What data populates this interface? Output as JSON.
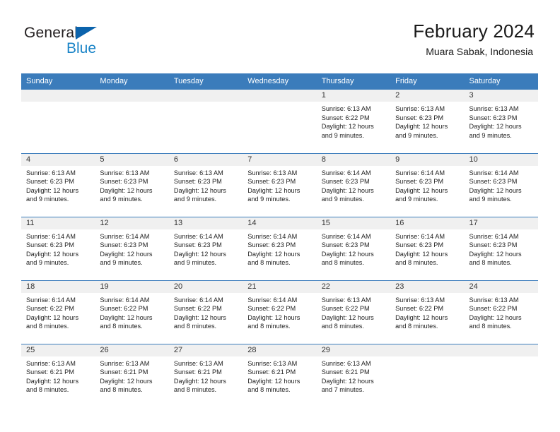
{
  "brand": {
    "name_top": "General",
    "name_bottom": "Blue",
    "triangle_color": "#0b63ac",
    "blue_text_color": "#1a84c7"
  },
  "header": {
    "title": "February 2024",
    "subtitle": "Muara Sabak, Indonesia"
  },
  "theme": {
    "header_blue": "#3b7cbb",
    "daynum_band": "#f0f0f0",
    "text": "#222222"
  },
  "weekday_headers": [
    "Sunday",
    "Monday",
    "Tuesday",
    "Wednesday",
    "Thursday",
    "Friday",
    "Saturday"
  ],
  "labels": {
    "sunrise_prefix": "Sunrise:",
    "sunset_prefix": "Sunset:",
    "daylight_prefix": "Daylight:"
  },
  "weeks": [
    [
      {
        "day": "",
        "sunrise": "",
        "sunset": "",
        "daylight_line1": "",
        "daylight_line2": "",
        "empty": true
      },
      {
        "day": "",
        "sunrise": "",
        "sunset": "",
        "daylight_line1": "",
        "daylight_line2": "",
        "empty": true
      },
      {
        "day": "",
        "sunrise": "",
        "sunset": "",
        "daylight_line1": "",
        "daylight_line2": "",
        "empty": true
      },
      {
        "day": "",
        "sunrise": "",
        "sunset": "",
        "daylight_line1": "",
        "daylight_line2": "",
        "empty": true
      },
      {
        "day": "1",
        "sunrise": "Sunrise: 6:13 AM",
        "sunset": "Sunset: 6:22 PM",
        "daylight_line1": "Daylight: 12 hours",
        "daylight_line2": "and 9 minutes.",
        "empty": false
      },
      {
        "day": "2",
        "sunrise": "Sunrise: 6:13 AM",
        "sunset": "Sunset: 6:23 PM",
        "daylight_line1": "Daylight: 12 hours",
        "daylight_line2": "and 9 minutes.",
        "empty": false
      },
      {
        "day": "3",
        "sunrise": "Sunrise: 6:13 AM",
        "sunset": "Sunset: 6:23 PM",
        "daylight_line1": "Daylight: 12 hours",
        "daylight_line2": "and 9 minutes.",
        "empty": false
      }
    ],
    [
      {
        "day": "4",
        "sunrise": "Sunrise: 6:13 AM",
        "sunset": "Sunset: 6:23 PM",
        "daylight_line1": "Daylight: 12 hours",
        "daylight_line2": "and 9 minutes.",
        "empty": false
      },
      {
        "day": "5",
        "sunrise": "Sunrise: 6:13 AM",
        "sunset": "Sunset: 6:23 PM",
        "daylight_line1": "Daylight: 12 hours",
        "daylight_line2": "and 9 minutes.",
        "empty": false
      },
      {
        "day": "6",
        "sunrise": "Sunrise: 6:13 AM",
        "sunset": "Sunset: 6:23 PM",
        "daylight_line1": "Daylight: 12 hours",
        "daylight_line2": "and 9 minutes.",
        "empty": false
      },
      {
        "day": "7",
        "sunrise": "Sunrise: 6:13 AM",
        "sunset": "Sunset: 6:23 PM",
        "daylight_line1": "Daylight: 12 hours",
        "daylight_line2": "and 9 minutes.",
        "empty": false
      },
      {
        "day": "8",
        "sunrise": "Sunrise: 6:14 AM",
        "sunset": "Sunset: 6:23 PM",
        "daylight_line1": "Daylight: 12 hours",
        "daylight_line2": "and 9 minutes.",
        "empty": false
      },
      {
        "day": "9",
        "sunrise": "Sunrise: 6:14 AM",
        "sunset": "Sunset: 6:23 PM",
        "daylight_line1": "Daylight: 12 hours",
        "daylight_line2": "and 9 minutes.",
        "empty": false
      },
      {
        "day": "10",
        "sunrise": "Sunrise: 6:14 AM",
        "sunset": "Sunset: 6:23 PM",
        "daylight_line1": "Daylight: 12 hours",
        "daylight_line2": "and 9 minutes.",
        "empty": false
      }
    ],
    [
      {
        "day": "11",
        "sunrise": "Sunrise: 6:14 AM",
        "sunset": "Sunset: 6:23 PM",
        "daylight_line1": "Daylight: 12 hours",
        "daylight_line2": "and 9 minutes.",
        "empty": false
      },
      {
        "day": "12",
        "sunrise": "Sunrise: 6:14 AM",
        "sunset": "Sunset: 6:23 PM",
        "daylight_line1": "Daylight: 12 hours",
        "daylight_line2": "and 9 minutes.",
        "empty": false
      },
      {
        "day": "13",
        "sunrise": "Sunrise: 6:14 AM",
        "sunset": "Sunset: 6:23 PM",
        "daylight_line1": "Daylight: 12 hours",
        "daylight_line2": "and 9 minutes.",
        "empty": false
      },
      {
        "day": "14",
        "sunrise": "Sunrise: 6:14 AM",
        "sunset": "Sunset: 6:23 PM",
        "daylight_line1": "Daylight: 12 hours",
        "daylight_line2": "and 8 minutes.",
        "empty": false
      },
      {
        "day": "15",
        "sunrise": "Sunrise: 6:14 AM",
        "sunset": "Sunset: 6:23 PM",
        "daylight_line1": "Daylight: 12 hours",
        "daylight_line2": "and 8 minutes.",
        "empty": false
      },
      {
        "day": "16",
        "sunrise": "Sunrise: 6:14 AM",
        "sunset": "Sunset: 6:23 PM",
        "daylight_line1": "Daylight: 12 hours",
        "daylight_line2": "and 8 minutes.",
        "empty": false
      },
      {
        "day": "17",
        "sunrise": "Sunrise: 6:14 AM",
        "sunset": "Sunset: 6:23 PM",
        "daylight_line1": "Daylight: 12 hours",
        "daylight_line2": "and 8 minutes.",
        "empty": false
      }
    ],
    [
      {
        "day": "18",
        "sunrise": "Sunrise: 6:14 AM",
        "sunset": "Sunset: 6:22 PM",
        "daylight_line1": "Daylight: 12 hours",
        "daylight_line2": "and 8 minutes.",
        "empty": false
      },
      {
        "day": "19",
        "sunrise": "Sunrise: 6:14 AM",
        "sunset": "Sunset: 6:22 PM",
        "daylight_line1": "Daylight: 12 hours",
        "daylight_line2": "and 8 minutes.",
        "empty": false
      },
      {
        "day": "20",
        "sunrise": "Sunrise: 6:14 AM",
        "sunset": "Sunset: 6:22 PM",
        "daylight_line1": "Daylight: 12 hours",
        "daylight_line2": "and 8 minutes.",
        "empty": false
      },
      {
        "day": "21",
        "sunrise": "Sunrise: 6:14 AM",
        "sunset": "Sunset: 6:22 PM",
        "daylight_line1": "Daylight: 12 hours",
        "daylight_line2": "and 8 minutes.",
        "empty": false
      },
      {
        "day": "22",
        "sunrise": "Sunrise: 6:13 AM",
        "sunset": "Sunset: 6:22 PM",
        "daylight_line1": "Daylight: 12 hours",
        "daylight_line2": "and 8 minutes.",
        "empty": false
      },
      {
        "day": "23",
        "sunrise": "Sunrise: 6:13 AM",
        "sunset": "Sunset: 6:22 PM",
        "daylight_line1": "Daylight: 12 hours",
        "daylight_line2": "and 8 minutes.",
        "empty": false
      },
      {
        "day": "24",
        "sunrise": "Sunrise: 6:13 AM",
        "sunset": "Sunset: 6:22 PM",
        "daylight_line1": "Daylight: 12 hours",
        "daylight_line2": "and 8 minutes.",
        "empty": false
      }
    ],
    [
      {
        "day": "25",
        "sunrise": "Sunrise: 6:13 AM",
        "sunset": "Sunset: 6:21 PM",
        "daylight_line1": "Daylight: 12 hours",
        "daylight_line2": "and 8 minutes.",
        "empty": false
      },
      {
        "day": "26",
        "sunrise": "Sunrise: 6:13 AM",
        "sunset": "Sunset: 6:21 PM",
        "daylight_line1": "Daylight: 12 hours",
        "daylight_line2": "and 8 minutes.",
        "empty": false
      },
      {
        "day": "27",
        "sunrise": "Sunrise: 6:13 AM",
        "sunset": "Sunset: 6:21 PM",
        "daylight_line1": "Daylight: 12 hours",
        "daylight_line2": "and 8 minutes.",
        "empty": false
      },
      {
        "day": "28",
        "sunrise": "Sunrise: 6:13 AM",
        "sunset": "Sunset: 6:21 PM",
        "daylight_line1": "Daylight: 12 hours",
        "daylight_line2": "and 8 minutes.",
        "empty": false
      },
      {
        "day": "29",
        "sunrise": "Sunrise: 6:13 AM",
        "sunset": "Sunset: 6:21 PM",
        "daylight_line1": "Daylight: 12 hours",
        "daylight_line2": "and 7 minutes.",
        "empty": false
      },
      {
        "day": "",
        "sunrise": "",
        "sunset": "",
        "daylight_line1": "",
        "daylight_line2": "",
        "empty": true
      },
      {
        "day": "",
        "sunrise": "",
        "sunset": "",
        "daylight_line1": "",
        "daylight_line2": "",
        "empty": true
      }
    ]
  ]
}
